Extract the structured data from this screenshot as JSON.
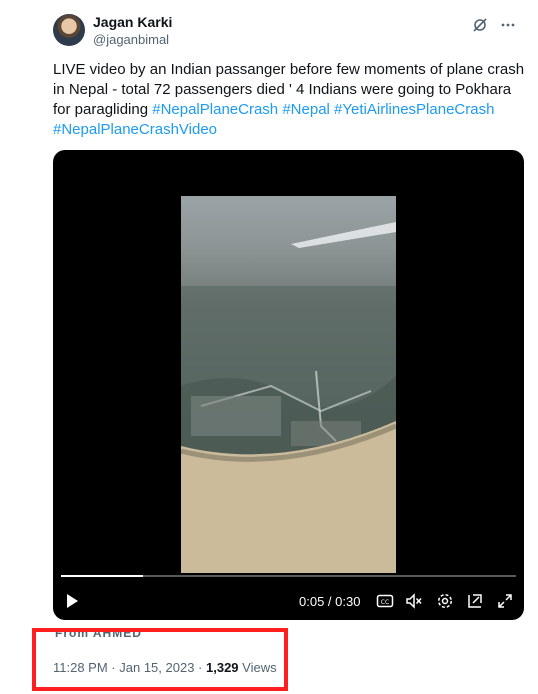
{
  "author": {
    "name": "Jagan Karki",
    "handle": "@jaganbimal"
  },
  "header_icons": [
    "grok-icon",
    "more-icon"
  ],
  "tweet": {
    "text": "LIVE video by an Indian passanger before few moments of plane crash in Nepal - total 72 passengers died ' 4 Indians were going to Pokhara for paragliding",
    "hashtags": [
      "#NepalPlaneCrash",
      "#Nepal",
      "#YetiAirlinesPlaneCrash",
      "#NepalPlaneCrashVideo"
    ]
  },
  "video": {
    "time_display": "0:05 / 0:30",
    "progress": 0.18,
    "controls": [
      "play-icon",
      "captions-icon",
      "mute-icon",
      "settings-icon",
      "pip-icon",
      "fullscreen-icon"
    ]
  },
  "overlay_text": "From AHMED",
  "meta": {
    "time": "11:28 PM",
    "separator1": " · ",
    "date": "Jan 15, 2023",
    "separator2": " · ",
    "views_count": "1,329",
    "views_label": " Views"
  },
  "colors": {
    "hashtag": "#1d9bf0",
    "highlight_box": "#ff1f1f"
  }
}
